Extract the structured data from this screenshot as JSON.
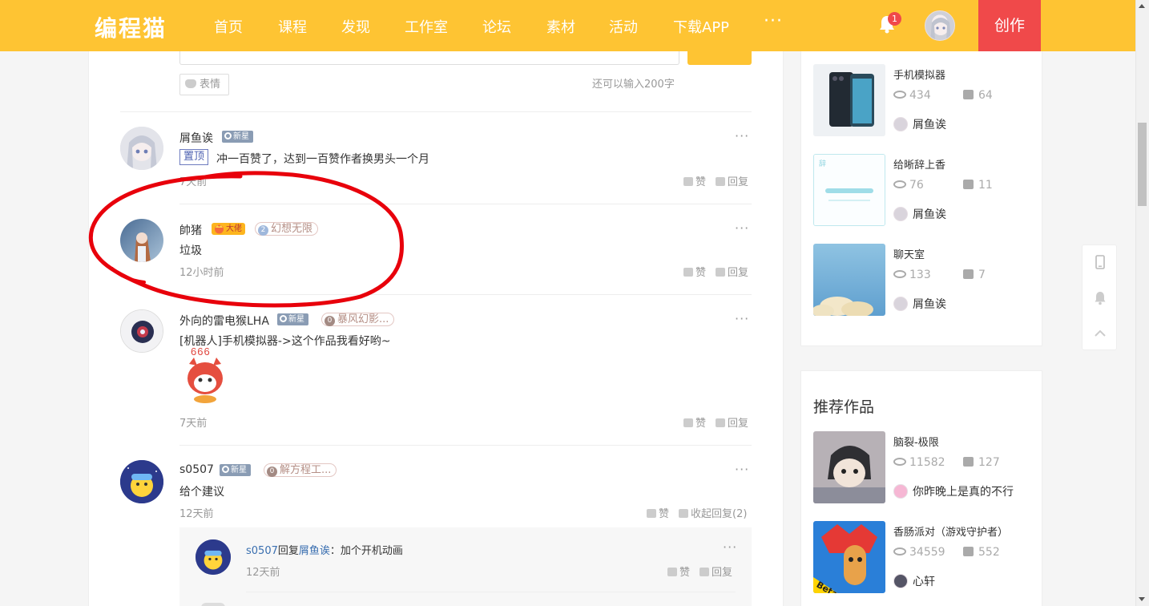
{
  "nav": {
    "logo": "编程猫",
    "items": [
      "首页",
      "课程",
      "发现",
      "工作室",
      "论坛",
      "素材",
      "活动",
      "下载APP"
    ],
    "more": "···",
    "notification_count": "1",
    "create_label": "创作"
  },
  "comment_input": {
    "emoji_label": "表情",
    "chars_left": "还可以输入200字"
  },
  "comments": [
    {
      "user": "屑鱼诶",
      "level_badge": "新星",
      "pin_label": "置顶",
      "text": "冲一百赞了，达到一百赞作者换男头一个月",
      "time": "7天前",
      "like": "赞",
      "reply": "回复"
    },
    {
      "user": "帥猪",
      "level_badge": "大佬",
      "group_num": "2",
      "group_name": "幻想无限",
      "text": "垃圾",
      "time": "12小时前",
      "like": "赞",
      "reply": "回复"
    },
    {
      "user": "外向的雷电猴LHA",
      "level_badge": "新星",
      "group_num": "0",
      "group_name": "暴风幻影...",
      "text": "[机器人]手机模拟器->这个作品我看好哟~",
      "sticker_text": "666",
      "time": "7天前",
      "like": "赞",
      "reply": "回复"
    },
    {
      "user": "s0507",
      "level_badge": "新星",
      "group_num": "0",
      "group_name": "解方程工...",
      "text": "给个建议",
      "time": "12天前",
      "like": "赞",
      "reply": "收起回复(2)"
    }
  ],
  "reply": {
    "user": "s0507",
    "verb": "回复",
    "target": "屑鱼诶",
    "text": "：加个开机动画",
    "time": "12天前",
    "like": "赞",
    "reply": "回复"
  },
  "author_works": [
    {
      "title": "手机模拟器",
      "views": "434",
      "likes": "64",
      "author": "屑鱼诶"
    },
    {
      "title": "给晰辞上香",
      "views": "76",
      "likes": "11",
      "author": "屑鱼诶"
    },
    {
      "title": "聊天室",
      "views": "133",
      "likes": "7",
      "author": "屑鱼诶"
    }
  ],
  "recommended": {
    "title": "推荐作品",
    "items": [
      {
        "title": "脑裂-极限",
        "views": "11582",
        "likes": "127",
        "author": "你昨晚上是真的不行"
      },
      {
        "title": "香肠派对（游戏守护者）",
        "views": "34559",
        "likes": "552",
        "author": "心轩"
      }
    ]
  },
  "colors": {
    "brand_yellow": "#fec433",
    "create_red": "#f0494a",
    "annotation_red": "#e8000b",
    "link_blue": "#3a6fb0"
  }
}
